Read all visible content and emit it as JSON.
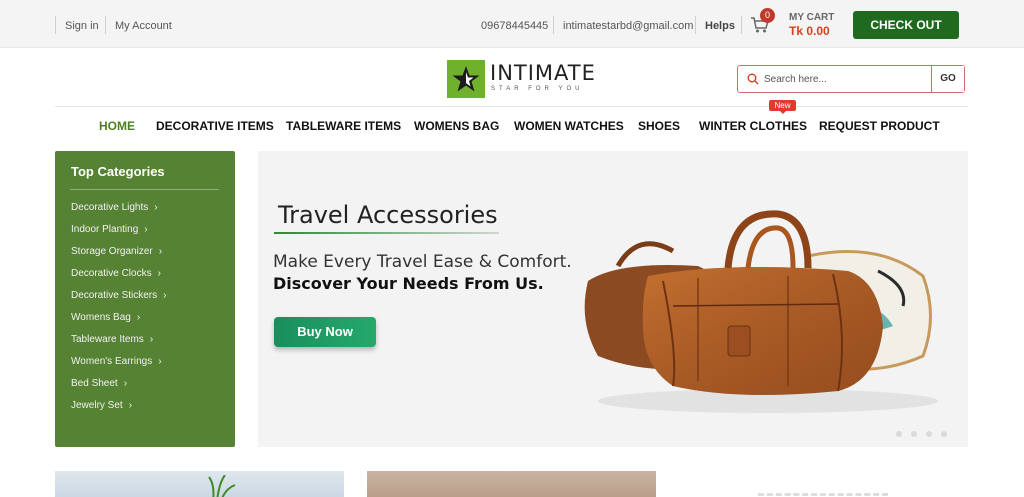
{
  "topbar": {
    "sign_in": "Sign in",
    "my_account": "My Account",
    "phone": "09678445445",
    "email": "intimatestarbd@gmail.com",
    "helps": "Helps",
    "cart_count": "0",
    "cart_label": "MY CART",
    "cart_total": "Tk 0.00",
    "checkout_label": "CHECK OUT"
  },
  "logo": {
    "name": "INTIMATE",
    "tagline": "STAR FOR YOU"
  },
  "search": {
    "placeholder": "Search here...",
    "go_label": "GO"
  },
  "nav": {
    "items": [
      {
        "label": "HOME"
      },
      {
        "label": "DECORATIVE ITEMS"
      },
      {
        "label": "TABLEWARE ITEMS"
      },
      {
        "label": "WOMENS BAG"
      },
      {
        "label": "WOMEN WATCHES"
      },
      {
        "label": "SHOES"
      },
      {
        "label": "WINTER CLOTHES"
      },
      {
        "label": "REQUEST PRODUCT"
      }
    ],
    "new_badge": "New"
  },
  "sidebar": {
    "title": "Top Categories",
    "items": [
      {
        "label": "Decorative Lights"
      },
      {
        "label": "Indoor Planting"
      },
      {
        "label": "Storage Organizer"
      },
      {
        "label": "Decorative Clocks"
      },
      {
        "label": "Decorative Stickers"
      },
      {
        "label": "Womens Bag"
      },
      {
        "label": "Tableware Items"
      },
      {
        "label": "Women's Earrings"
      },
      {
        "label": "Bed Sheet"
      },
      {
        "label": "Jewelry Set"
      }
    ]
  },
  "banner": {
    "title": "Travel Accessories",
    "line1": "Make Every Travel Ease & Comfort.",
    "line2": "Discover Your Needs From Us.",
    "button_label": "Buy Now"
  },
  "colors": {
    "brand_green": "#568233",
    "checkout_green": "#1f6a1f",
    "accent_red": "#e23b2e"
  }
}
